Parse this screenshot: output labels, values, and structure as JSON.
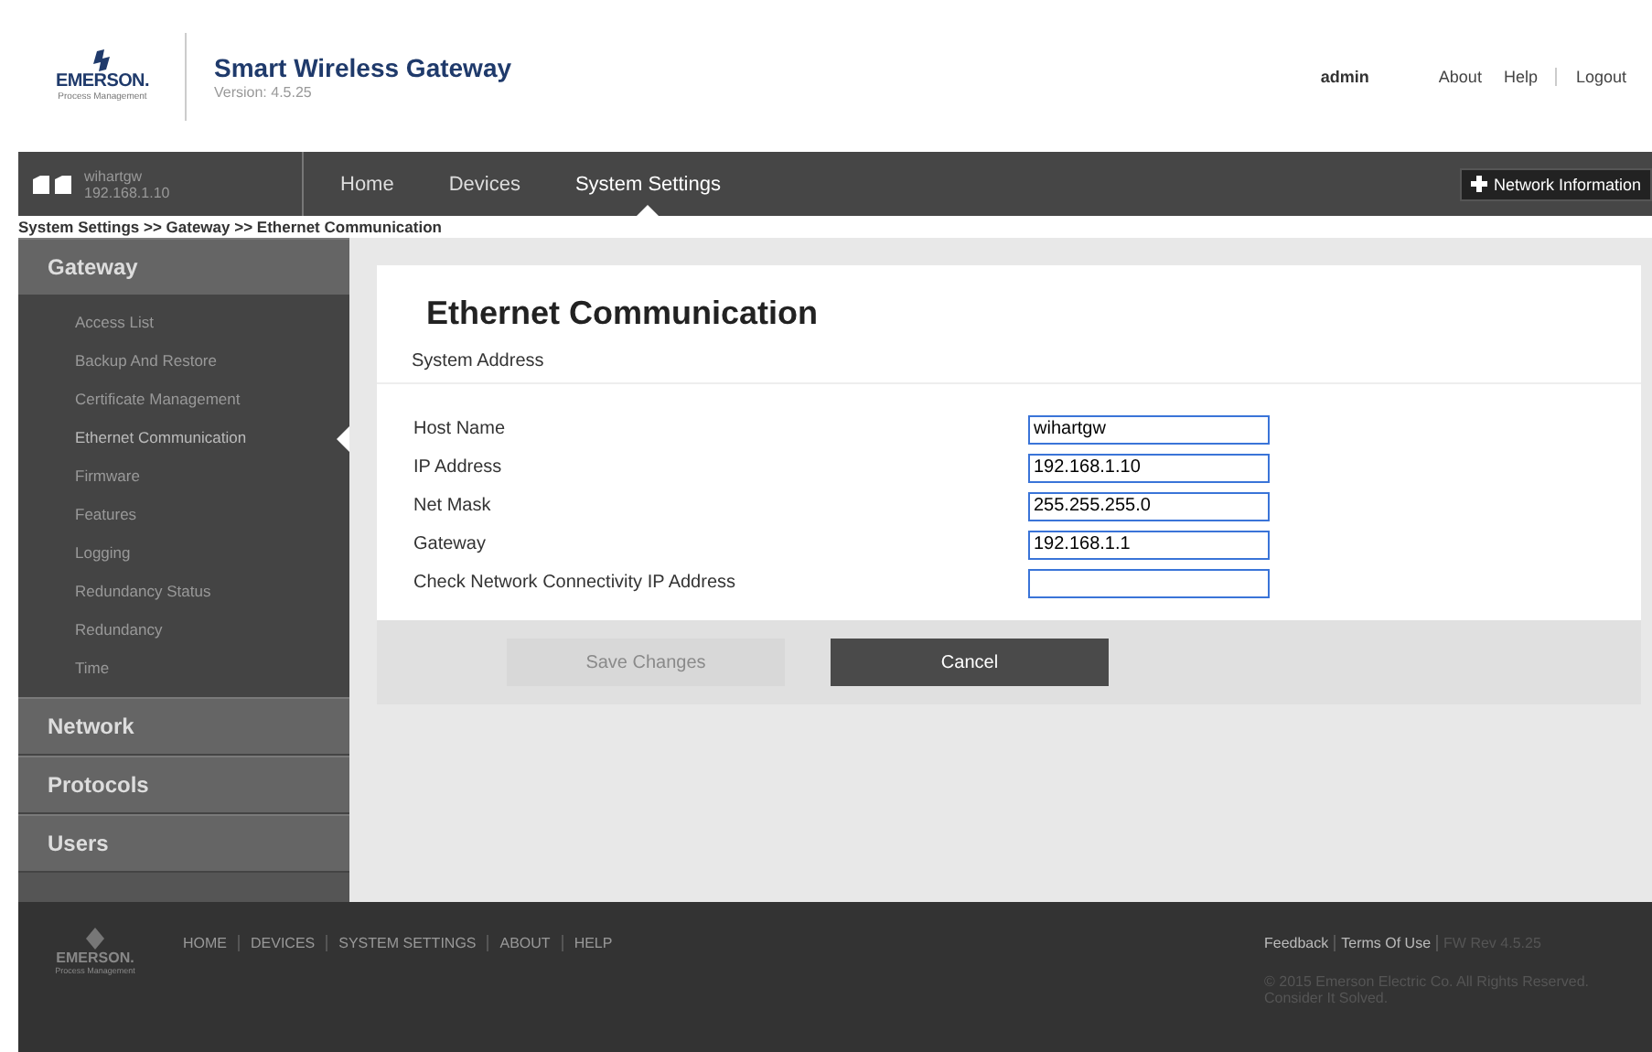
{
  "header": {
    "logo": {
      "brand": "EMERSON.",
      "subtitle": "Process Management"
    },
    "title": "Smart Wireless Gateway",
    "version": "Version: 4.5.25",
    "user": "admin",
    "links": [
      "About",
      "Help",
      "Logout"
    ]
  },
  "navbar": {
    "device_name": "wihartgw",
    "device_ip": "192.168.1.10",
    "menu": [
      {
        "label": "Home",
        "selected": false
      },
      {
        "label": "Devices",
        "selected": false
      },
      {
        "label": "System Settings",
        "selected": true
      }
    ],
    "network_button": "Network Information"
  },
  "breadcrumb": "System Settings >> Gateway >> Ethernet Communication",
  "sidebar": [
    {
      "label": "Gateway",
      "children": [
        {
          "label": "Access List",
          "selected": false
        },
        {
          "label": "Backup And Restore",
          "selected": false
        },
        {
          "label": "Certificate Management",
          "selected": false
        },
        {
          "label": "Ethernet Communication",
          "selected": true
        },
        {
          "label": "Firmware",
          "selected": false
        },
        {
          "label": "Features",
          "selected": false
        },
        {
          "label": "Logging",
          "selected": false
        },
        {
          "label": "Redundancy Status",
          "selected": false
        },
        {
          "label": "Redundancy",
          "selected": false
        },
        {
          "label": "Time",
          "selected": false
        }
      ]
    },
    {
      "label": "Network"
    },
    {
      "label": "Protocols"
    },
    {
      "label": "Users"
    }
  ],
  "form": {
    "title": "Ethernet Communication",
    "section": "System Address",
    "fields": [
      {
        "label": "Host Name",
        "value": "wihartgw"
      },
      {
        "label": "IP Address",
        "value": "192.168.1.10"
      },
      {
        "label": "Net Mask",
        "value": "255.255.255.0"
      },
      {
        "label": "Gateway",
        "value": "192.168.1.1"
      },
      {
        "label": "Check Network Connectivity IP Address"
      }
    ],
    "buttons": [
      {
        "label": "Save Changes",
        "disabled": true
      },
      {
        "label": "Cancel",
        "disabled": false
      }
    ]
  },
  "footer": {
    "logo": {
      "brand": "EMERSON.",
      "subtitle": "Process Management"
    },
    "links": [
      "HOME",
      "DEVICES",
      "SYSTEM SETTINGS",
      "ABOUT",
      "HELP"
    ],
    "feedback": "Feedback",
    "terms": "Terms Of Use",
    "fw": "FW Rev 4.5.25",
    "copyright": "© 2015 Emerson Electric Co. All Rights Reserved.",
    "slogan": "Consider It Solved."
  }
}
